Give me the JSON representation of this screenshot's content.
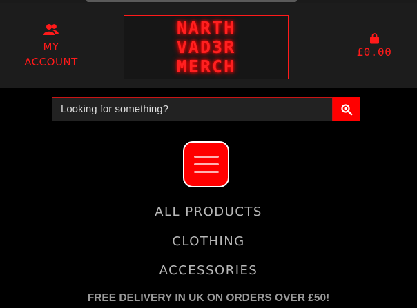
{
  "header": {
    "account": {
      "line1": "MY",
      "line2": "ACCOUNT",
      "icon": "users-icon"
    },
    "logo": {
      "line1": "NARTH",
      "line2": "VAD3R",
      "line3": "MERCH"
    },
    "cart": {
      "total": "£0.00",
      "icon": "shopping-bag-icon"
    }
  },
  "search": {
    "placeholder": "Looking for something?",
    "button_icon": "search-icon"
  },
  "menu_toggle": {
    "icon": "hamburger-icon"
  },
  "nav": {
    "items": [
      "ALL PRODUCTS",
      "CLOTHING",
      "ACCESSORIES"
    ]
  },
  "promo": {
    "text": "FREE DELIVERY IN UK ON ORDERS OVER £50!"
  },
  "colors": {
    "accent": "#ff0000",
    "header_bg": "#1c1c1c",
    "page_bg": "#000000",
    "nav_text": "#b8b8b8"
  }
}
